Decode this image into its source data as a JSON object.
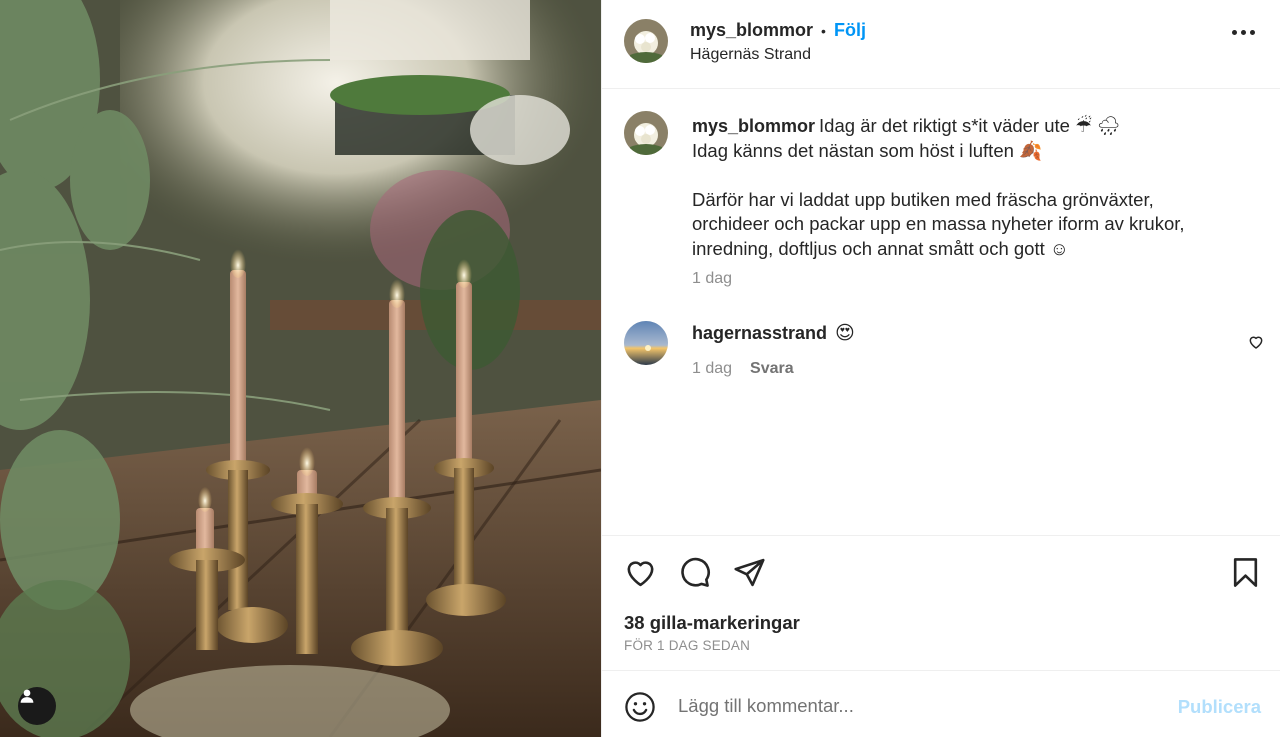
{
  "post": {
    "username": "mys_blommor",
    "separator": "•",
    "follow_label": "Följ",
    "location": "Hägernäs Strand"
  },
  "caption": {
    "username": "mys_blommor",
    "line1": "Idag är det riktigt s*it väder ute ☔ 🌧",
    "line2": "Idag känns det nästan som höst i luften 🍂",
    "para2_line1": "Därför har vi laddat upp butiken med fräscha grönväxter,",
    "para2_line2": "orchideer och packar upp en massa nyheter iform av krukor,",
    "para2_line3": "inredning, doftljus och annat smått och gott ☺",
    "time": "1 dag"
  },
  "comment": {
    "username": "hagernasstrand",
    "text": "😍",
    "time": "1 dag",
    "reply_label": "Svara"
  },
  "engagement": {
    "likes": "38 gilla-markeringar",
    "date": "FÖR 1 DAG SEDAN"
  },
  "comment_box": {
    "placeholder": "Lägg till kommentar...",
    "publish_label": "Publicera"
  },
  "icons": {
    "like": "heart-icon",
    "comment": "comment-bubble-icon",
    "share": "paper-plane-icon",
    "save": "bookmark-icon",
    "emoji": "smiley-icon",
    "more": "more-options-icon",
    "user_tag": "user-tag-icon"
  },
  "colors": {
    "accent": "#0095f6",
    "publish_disabled": "#b2dffc",
    "muted": "#8e8e8e",
    "text": "#262626"
  }
}
